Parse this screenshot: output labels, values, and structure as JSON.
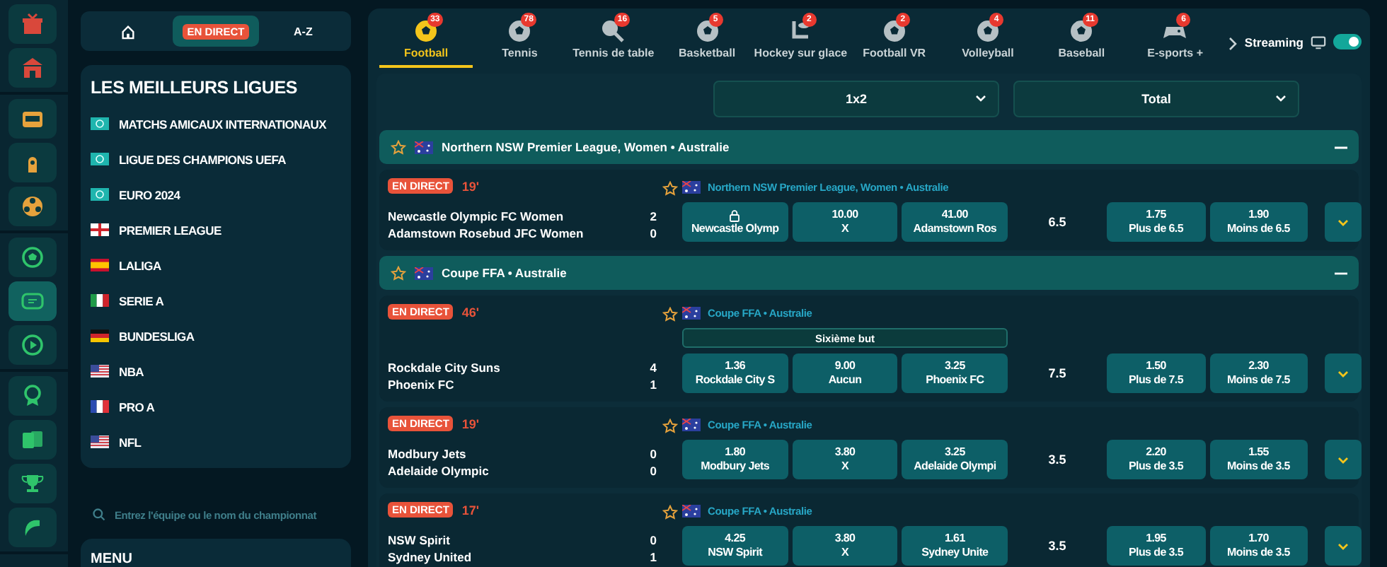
{
  "rail": [
    {
      "color": "#d9483b",
      "items": [
        {
          "kind": "gift",
          "selected": false
        },
        {
          "kind": "store",
          "selected": false
        }
      ]
    },
    {
      "color": "#e6a23c",
      "items": [
        {
          "kind": "slot",
          "selected": false
        },
        {
          "kind": "keyhole",
          "selected": false
        },
        {
          "kind": "reel",
          "selected": false
        }
      ]
    },
    {
      "color": "#2fc46b",
      "items": [
        {
          "kind": "ball",
          "selected": false
        },
        {
          "kind": "screen",
          "selected": true
        },
        {
          "kind": "play",
          "selected": false
        }
      ]
    },
    {
      "color": "#2fc46b",
      "items": [
        {
          "kind": "medal",
          "selected": false
        },
        {
          "kind": "cards",
          "selected": false
        },
        {
          "kind": "trophy",
          "selected": false
        },
        {
          "kind": "swoosh",
          "selected": false
        }
      ]
    }
  ],
  "sidebar": {
    "tabs": [
      {
        "kind": "home",
        "selected": false
      },
      {
        "kind": "badge",
        "label": "EN DIRECT",
        "selected": true
      },
      {
        "kind": "text",
        "label": "A-Z",
        "selected": false
      }
    ],
    "leagues_title": "LES MEILLEURS LIGUES",
    "leagues": [
      {
        "label": "MATCHS AMICAUX INTERNATIONAUX",
        "kind": "world"
      },
      {
        "label": "LIGUE DES CHAMPIONS UEFA",
        "kind": "world"
      },
      {
        "label": "EURO 2024",
        "kind": "world"
      },
      {
        "label": "PREMIER LEAGUE",
        "kind": "england"
      },
      {
        "label": "LALIGA",
        "kind": "spain"
      },
      {
        "label": "SERIE A",
        "kind": "italy"
      },
      {
        "label": "BUNDESLIGA",
        "kind": "germany"
      },
      {
        "label": "NBA",
        "kind": "usa"
      },
      {
        "label": "PRO A",
        "kind": "france"
      },
      {
        "label": "NFL",
        "kind": "usa"
      }
    ],
    "search": {
      "placeholder": "Entrez l'équipe ou le nom du championnat"
    },
    "menu_title": "MENU"
  },
  "sports": [
    {
      "label": "Football",
      "count": "33",
      "kind": "ball",
      "selected": true
    },
    {
      "label": "Tennis",
      "count": "78",
      "kind": "ball",
      "selected": false
    },
    {
      "label": "Tennis de table",
      "count": "16",
      "kind": "paddle",
      "selected": false
    },
    {
      "label": "Basketball",
      "count": "5",
      "kind": "ball",
      "selected": false
    },
    {
      "label": "Hockey sur glace",
      "count": "2",
      "kind": "stick",
      "selected": false
    },
    {
      "label": "Football VR",
      "count": "2",
      "kind": "ball",
      "selected": false
    },
    {
      "label": "Volleyball",
      "count": "4",
      "kind": "ball",
      "selected": false
    },
    {
      "label": "Baseball",
      "count": "11",
      "kind": "ball",
      "selected": false
    },
    {
      "label": "E-sports +",
      "count": "6",
      "kind": "gamepad",
      "selected": false
    }
  ],
  "streaming": {
    "label": "Streaming",
    "on": true
  },
  "markets": [
    "1x2",
    "Total"
  ],
  "groups": [
    {
      "title": "Northern NSW Premier League, Women • Australie",
      "flag": {
        "kind": "australia"
      },
      "expanded": true,
      "matches": [
        {
          "live": "EN DIRECT",
          "minute": "19'",
          "teams": [
            "Newcastle Olympic FC Women",
            "Adamstown Rosebud JFC Women"
          ],
          "scores": [
            "2",
            "0"
          ],
          "league": "Northern NSW Premier League, Women • Australie",
          "flag": {
            "kind": "australia"
          },
          "odds": [
            {
              "label": "Newcastle Olymp",
              "locked": true
            },
            {
              "value": "10.00",
              "label": "X",
              "locked": false
            },
            {
              "value": "41.00",
              "label": "Adamstown Ros",
              "locked": false
            }
          ],
          "line": "6.5",
          "totals": [
            {
              "value": "1.75",
              "label": "Plus de 6.5"
            },
            {
              "value": "1.90",
              "label": "Moins de 6.5"
            }
          ]
        }
      ]
    },
    {
      "title": "Coupe FFA • Australie",
      "flag": {
        "kind": "australia"
      },
      "expanded": true,
      "matches": [
        {
          "live": "EN DIRECT",
          "minute": "46'",
          "teams": [
            "Rockdale City Suns",
            "Phoenix FC"
          ],
          "scores": [
            "4",
            "1"
          ],
          "league": "Coupe FFA • Australie",
          "flag": {
            "kind": "australia"
          },
          "market": "Sixième but",
          "odds": [
            {
              "value": "1.36",
              "label": "Rockdale City S",
              "locked": false
            },
            {
              "value": "9.00",
              "label": "Aucun",
              "locked": false
            },
            {
              "value": "3.25",
              "label": "Phoenix FC",
              "locked": false
            }
          ],
          "line": "7.5",
          "totals": [
            {
              "value": "1.50",
              "label": "Plus de 7.5"
            },
            {
              "value": "2.30",
              "label": "Moins de 7.5"
            }
          ]
        },
        {
          "live": "EN DIRECT",
          "minute": "19'",
          "teams": [
            "Modbury Jets",
            "Adelaide Olympic"
          ],
          "scores": [
            "0",
            "0"
          ],
          "league": "Coupe FFA • Australie",
          "flag": {
            "kind": "australia"
          },
          "odds": [
            {
              "value": "1.80",
              "label": "Modbury Jets",
              "locked": false
            },
            {
              "value": "3.80",
              "label": "X",
              "locked": false
            },
            {
              "value": "3.25",
              "label": "Adelaide Olympi",
              "locked": false
            }
          ],
          "line": "3.5",
          "totals": [
            {
              "value": "2.20",
              "label": "Plus de 3.5"
            },
            {
              "value": "1.55",
              "label": "Moins de 3.5"
            }
          ]
        },
        {
          "live": "EN DIRECT",
          "minute": "17'",
          "teams": [
            "NSW Spirit",
            "Sydney United"
          ],
          "scores": [
            "0",
            "1"
          ],
          "league": "Coupe FFA • Australie",
          "flag": {
            "kind": "australia"
          },
          "odds": [
            {
              "value": "4.25",
              "label": "NSW Spirit",
              "locked": false
            },
            {
              "value": "3.80",
              "label": "X",
              "locked": false
            },
            {
              "value": "1.61",
              "label": "Sydney Unite",
              "locked": false
            }
          ],
          "line": "3.5",
          "totals": [
            {
              "value": "1.95",
              "label": "Plus de 3.5"
            },
            {
              "value": "1.70",
              "label": "Moins de 3.5"
            }
          ]
        }
      ]
    }
  ]
}
